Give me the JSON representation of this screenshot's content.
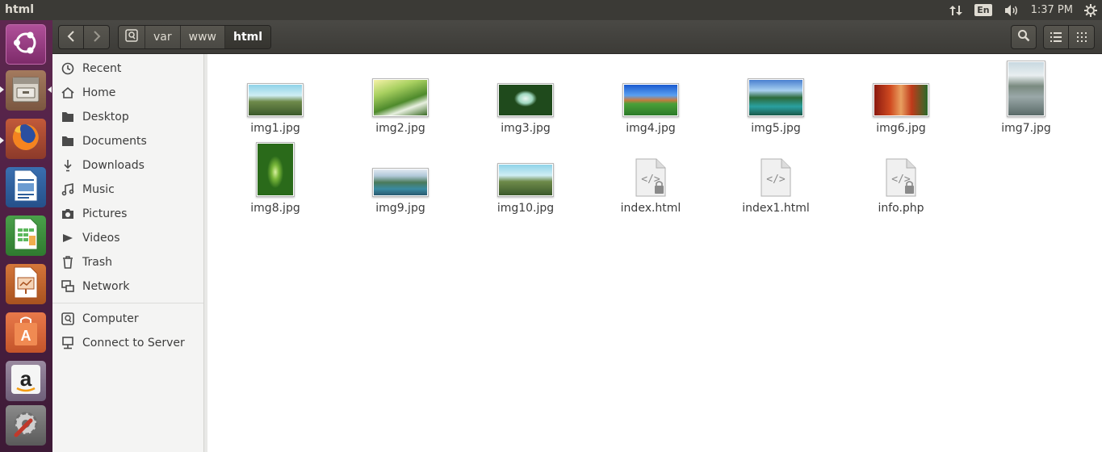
{
  "top_panel": {
    "window_title": "html",
    "keyboard_layout": "En",
    "clock": "1:37 PM"
  },
  "launcher": {
    "items": [
      {
        "name": "ubuntu-dash"
      },
      {
        "name": "files"
      },
      {
        "name": "firefox"
      },
      {
        "name": "libreoffice-writer"
      },
      {
        "name": "libreoffice-calc"
      },
      {
        "name": "libreoffice-impress"
      },
      {
        "name": "ubuntu-software"
      },
      {
        "name": "amazon"
      },
      {
        "name": "system-settings"
      }
    ]
  },
  "breadcrumb": {
    "items": [
      "var",
      "www",
      "html"
    ],
    "active": "html"
  },
  "sidebar": {
    "items": [
      {
        "label": "Recent",
        "icon": "clock-icon"
      },
      {
        "label": "Home",
        "icon": "home-icon"
      },
      {
        "label": "Desktop",
        "icon": "folder-icon"
      },
      {
        "label": "Documents",
        "icon": "folder-icon"
      },
      {
        "label": "Downloads",
        "icon": "download-icon"
      },
      {
        "label": "Music",
        "icon": "music-icon"
      },
      {
        "label": "Pictures",
        "icon": "camera-icon"
      },
      {
        "label": "Videos",
        "icon": "video-icon"
      },
      {
        "label": "Trash",
        "icon": "trash-icon"
      },
      {
        "label": "Network",
        "icon": "network-icon"
      }
    ],
    "devices": [
      {
        "label": "Computer",
        "icon": "drive-icon"
      },
      {
        "label": "Connect to Server",
        "icon": "server-icon"
      }
    ]
  },
  "files": [
    {
      "name": "img1.jpg",
      "type": "image"
    },
    {
      "name": "img2.jpg",
      "type": "image"
    },
    {
      "name": "img3.jpg",
      "type": "image"
    },
    {
      "name": "img4.jpg",
      "type": "image"
    },
    {
      "name": "img5.jpg",
      "type": "image"
    },
    {
      "name": "img6.jpg",
      "type": "image"
    },
    {
      "name": "img7.jpg",
      "type": "image"
    },
    {
      "name": "img8.jpg",
      "type": "image"
    },
    {
      "name": "img9.jpg",
      "type": "image"
    },
    {
      "name": "img10.jpg",
      "type": "image"
    },
    {
      "name": "index.html",
      "type": "html"
    },
    {
      "name": "index1.html",
      "type": "html"
    },
    {
      "name": "info.php",
      "type": "php"
    }
  ],
  "colors": {
    "panel": "#3b3a36",
    "launcher": "#5e2750",
    "headerbar": "#3c3b37",
    "sidebar_bg": "#f4f4f3",
    "text": "#3c3c3c"
  }
}
